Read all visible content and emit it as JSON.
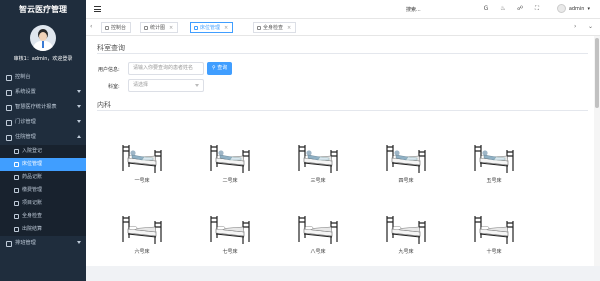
{
  "app": {
    "title": "智云医疗管理"
  },
  "user": {
    "greeting": "审核1：admin，欢迎登录"
  },
  "sidebar": {
    "items": [
      {
        "label": "控制台"
      },
      {
        "label": "系统设置"
      },
      {
        "label": "智慧医疗统计报表"
      },
      {
        "label": "门诊管理"
      },
      {
        "label": "住院管理"
      },
      {
        "label": "排班管理"
      }
    ],
    "subitems": [
      {
        "label": "入院登记"
      },
      {
        "label": "床位管理"
      },
      {
        "label": "药品记账"
      },
      {
        "label": "缴费管理"
      },
      {
        "label": "项目记账"
      },
      {
        "label": "全身检查"
      },
      {
        "label": "出院结算"
      }
    ]
  },
  "header": {
    "search_label": "搜索...",
    "icons": [
      "github-icon",
      "bell-icon",
      "lock-icon",
      "fullscreen-icon"
    ],
    "admin_name": "admin"
  },
  "tabs": [
    {
      "label": "控制台"
    },
    {
      "label": "统计图"
    },
    {
      "label": "床位管理"
    },
    {
      "label": "全身检查"
    }
  ],
  "query": {
    "title": "科室查询",
    "user_label": "用户信息:",
    "user_placeholder": "请输入你要查询的患者姓名",
    "search_button": "查询",
    "dept_label": "科室:",
    "dept_placeholder": "请选择"
  },
  "department": {
    "title": "内科"
  },
  "beds": [
    {
      "label": "一号床",
      "occupied": true
    },
    {
      "label": "二号床",
      "occupied": true
    },
    {
      "label": "三号床",
      "occupied": true
    },
    {
      "label": "四号床",
      "occupied": true
    },
    {
      "label": "五号床",
      "occupied": true
    },
    {
      "label": "六号床",
      "occupied": false
    },
    {
      "label": "七号床",
      "occupied": false
    },
    {
      "label": "八号床",
      "occupied": false
    },
    {
      "label": "九号床",
      "occupied": false
    },
    {
      "label": "十号床",
      "occupied": false
    }
  ],
  "colors": {
    "sidebar_bg": "#1f2d3d",
    "accent": "#409eff"
  }
}
